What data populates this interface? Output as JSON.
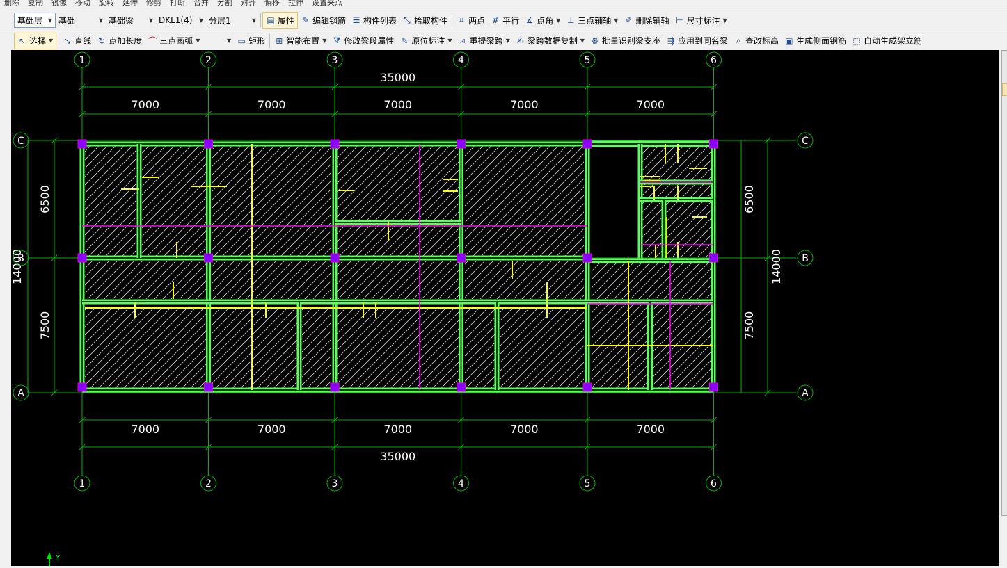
{
  "top_strip": [
    "删除",
    "复制",
    "镜像",
    "移动",
    "旋转",
    "延伸",
    "修剪",
    "打断",
    "合并",
    "分割",
    "对齐",
    "偏移",
    "拉伸",
    "设置夹点"
  ],
  "toolbar1": {
    "layer": "基础层",
    "type": "基础",
    "subtype": "基础梁",
    "component": "DKL1(4)",
    "floor": "分层1",
    "properties": "属性",
    "edit_rebar": "编辑钢筋",
    "component_list": "构件列表",
    "pick_component": "拾取构件",
    "two_points": "两点",
    "parallel": "平行",
    "point_angle": "点角",
    "three_point_axis": "三点辅轴",
    "delete_axis": "删除辅轴",
    "dimension": "尺寸标注"
  },
  "toolbar2": {
    "select": "选择",
    "line": "直线",
    "point_length": "点加长度",
    "arc": "三点画弧",
    "rect": "矩形",
    "smart_layout": "智能布置",
    "modify_span": "修改梁段属性",
    "in_place_mark": "原位标注",
    "reextract_span": "重提梁跨",
    "copy_span_data": "梁跨数据复制",
    "batch_identify": "批量识别梁支座",
    "apply_same": "应用到同名梁",
    "modify_elev": "查改标高",
    "side_rebar": "生成侧面钢筋",
    "stand_rebar": "自动生成架立筋"
  },
  "grid": {
    "columns": [
      "1",
      "2",
      "3",
      "4",
      "5",
      "6"
    ],
    "rows": [
      "C",
      "B",
      "A"
    ],
    "span_dims": [
      "7000",
      "7000",
      "7000",
      "7000",
      "7000"
    ],
    "total_width": "35000",
    "row_dims": [
      "6500",
      "7500"
    ],
    "total_height": "14000"
  },
  "axis_indicator": "Y",
  "colors": {
    "canvas": "#000000",
    "grid_line": "#00b400",
    "beam": "#59ff59",
    "secondary_beam": "#ffff00",
    "rebar_line": "#ff00ff",
    "column": "#8a00ff",
    "dimension_text": "#ffffff"
  }
}
